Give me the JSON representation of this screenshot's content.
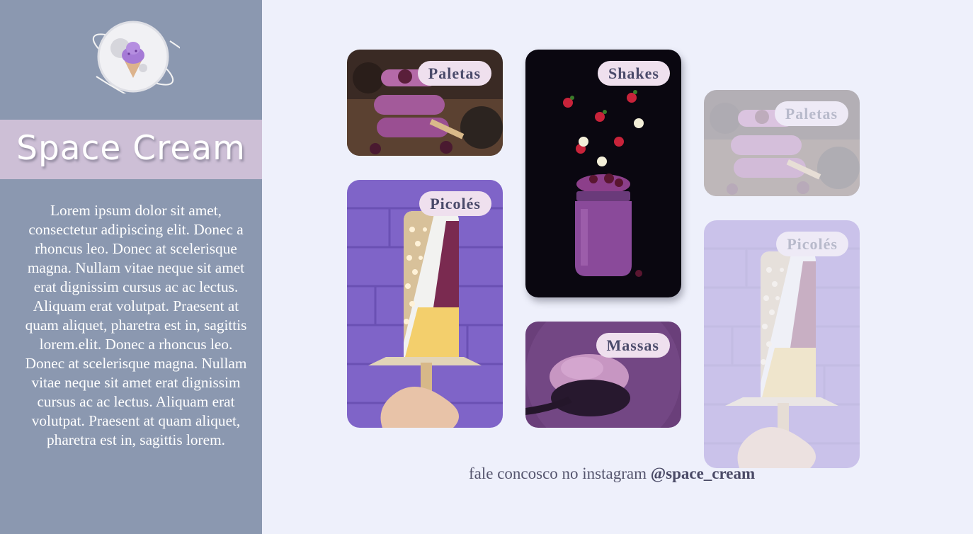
{
  "sidebar": {
    "brand_title": "Space Cream",
    "intro_text": "Lorem ipsum dolor sit amet, consectetur adipiscing elit. Donec a rhoncus leo. Donec at scelerisque magna. Nullam vitae neque sit amet erat dignissim cursus ac ac lectus. Aliquam erat volutpat. Praesent at quam aliquet, pharetra est in, sagittis lorem.elit. Donec a rhoncus leo. Donec at scelerisque magna. Nullam vitae neque sit amet erat dignissim cursus ac ac lectus. Aliquam erat volutpat. Praesent at quam aliquet, pharetra est in, sagittis lorem.",
    "logo_icon": "ice-cream-planet-icon"
  },
  "gallery": {
    "cards": [
      {
        "label": "Paletas",
        "image": "popsicle-stack-photo"
      },
      {
        "label": "Picolés",
        "image": "popsicle-hand-photo"
      },
      {
        "label": "Shakes",
        "image": "shake-jar-photo"
      },
      {
        "label": "Massas",
        "image": "ice-cream-scoop-photo"
      },
      {
        "label": "Paletas",
        "image": "popsicle-stack-photo"
      },
      {
        "label": "Picolés",
        "image": "popsicle-hand-photo"
      }
    ]
  },
  "footer": {
    "text": "fale concosco no instagram",
    "handle": "@space_cream"
  },
  "colors": {
    "sidebar_bg": "#8b98b0",
    "brand_band": "#cdbfd6",
    "page_bg": "#eef0fb",
    "tag_bg": "#efe0ee",
    "tag_text": "#4a4a6a"
  }
}
